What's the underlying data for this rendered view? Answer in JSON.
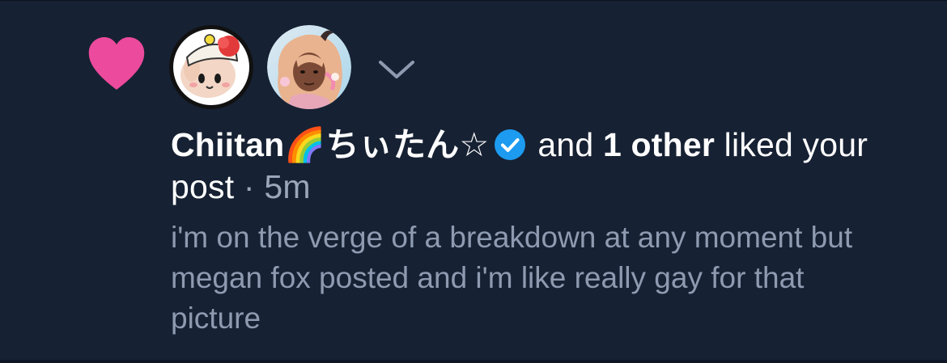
{
  "notification": {
    "type_icon": "heart-icon",
    "accent_color": "#ec4a9c",
    "avatars": [
      {
        "icon": "avatar-icon",
        "label": "Chiitan avatar"
      },
      {
        "icon": "avatar-icon",
        "label": "other user avatar"
      }
    ],
    "expand_icon": "chevron-down-icon",
    "actor_name": "Chiitan🌈ちぃたん☆",
    "verified_icon": "verified-badge-icon",
    "verified_color": "#1d9bf0",
    "joiner": "and",
    "others": "1 other",
    "action": "liked your post",
    "separator": "·",
    "time": "5m",
    "excerpt": "i'm on the verge of a breakdown at any moment but megan fox posted and i'm like really gay for that picture"
  }
}
